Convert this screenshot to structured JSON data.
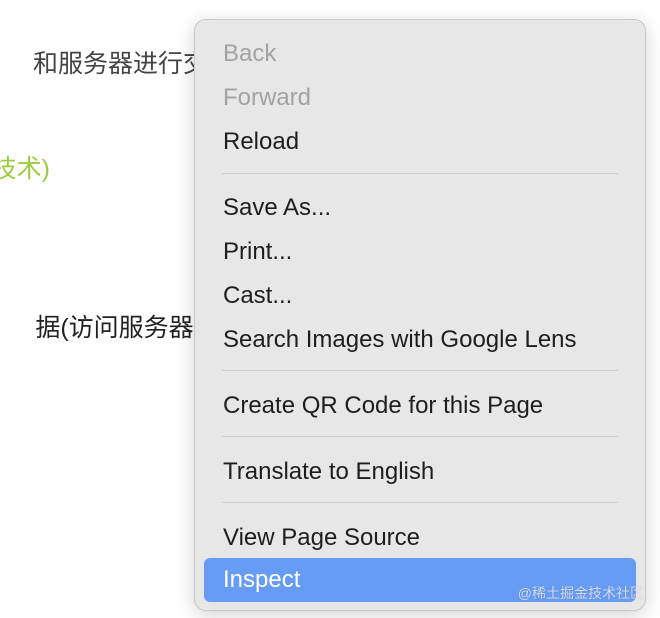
{
  "background_text": {
    "line1": "和服务器进行交",
    "line2": "技术)",
    "line3": "据(访问服务器)"
  },
  "context_menu": {
    "items": [
      {
        "label": "Back",
        "disabled": true
      },
      {
        "label": "Forward",
        "disabled": true
      },
      {
        "label": "Reload"
      },
      {
        "label": "Save As..."
      },
      {
        "label": "Print..."
      },
      {
        "label": "Cast..."
      },
      {
        "label": "Search Images with Google Lens"
      },
      {
        "label": "Create QR Code for this Page"
      },
      {
        "label": "Translate to English"
      },
      {
        "label": "View Page Source"
      },
      {
        "label": "Inspect",
        "highlighted": true
      }
    ]
  },
  "watermark": "@稀土掘金技术社区",
  "colors": {
    "highlight": "#679cf5",
    "menu_bg": "#e8e7e8",
    "green_text": "#9ccc45"
  }
}
